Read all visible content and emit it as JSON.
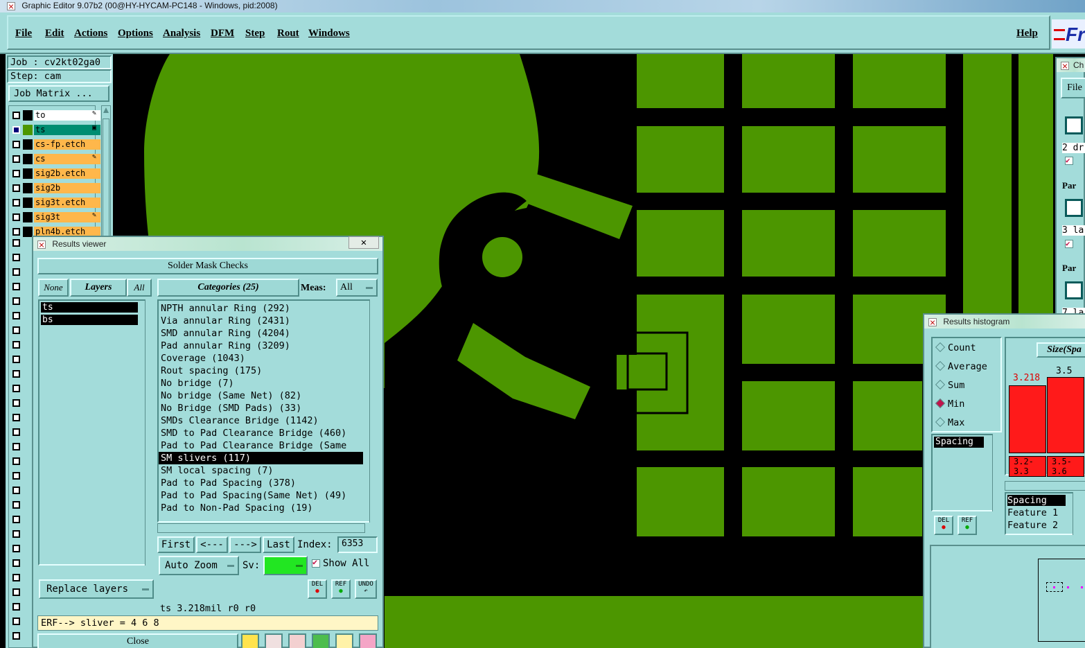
{
  "window_title": "Graphic Editor 9.07b2 (00@HY-HYCAM-PC148 - Windows, pid:2008)",
  "menu": [
    "File",
    "Edit",
    "Actions",
    "Options",
    "Analysis",
    "DFM",
    "Step",
    "Rout",
    "Windows"
  ],
  "help_label": "Help",
  "logo_text": "Fr",
  "job_label": "Job : cv2kt02ga0",
  "step_label": "Step: cam",
  "job_matrix_label": "Job Matrix ...",
  "layers": [
    {
      "name": "to",
      "color": "#ffffff",
      "flag": "✎"
    },
    {
      "name": "ts",
      "color": "#008d72",
      "flag": "▣"
    },
    {
      "name": "cs-fp.etch",
      "color": "#ffb74b",
      "flag": ""
    },
    {
      "name": "cs",
      "color": "#ffb74b",
      "flag": "✎"
    },
    {
      "name": "sig2b.etch",
      "color": "#ffb74b",
      "flag": ""
    },
    {
      "name": "sig2b",
      "color": "#ffb74b",
      "flag": ""
    },
    {
      "name": "sig3t.etch",
      "color": "#ffb74b",
      "flag": ""
    },
    {
      "name": "sig3t",
      "color": "#ffb74b",
      "flag": "✎"
    },
    {
      "name": "pln4b.etch",
      "color": "#ffb74b",
      "flag": ""
    }
  ],
  "results_viewer": {
    "title": "Results viewer",
    "header": "Solder Mask Checks",
    "none_label": "None",
    "layers_label": "Layers",
    "all_label": "All",
    "categories_label": "Categories (25)",
    "meas_label": "Meas:",
    "meas_value": "All",
    "layer_list": [
      "ts",
      "bs"
    ],
    "categories": [
      "NPTH annular Ring (292)",
      "Via annular Ring (2431)",
      "SMD annular Ring (4204)",
      "Pad annular Ring (3209)",
      "Coverage (1043)",
      "Rout spacing (175)",
      "No bridge (7)",
      "No bridge (Same Net) (82)",
      "No Bridge (SMD Pads) (33)",
      "SMDs Clearance Bridge (1142)",
      "SMD to Pad Clearance Bridge (460)",
      "Pad to Pad Clearance Bridge (Same",
      "SM slivers (117)",
      "SM local spacing (7)",
      "Pad to Pad Spacing (378)",
      "Pad to Pad Spacing(Same Net) (49)",
      "Pad to Non-Pad Spacing (19)"
    ],
    "selected_category": "SM slivers (117)",
    "first_label": "First",
    "prev_label": "<---",
    "next_label": "--->",
    "last_label": "Last",
    "index_label": "Index:",
    "index_value": "6353",
    "auto_zoom_label": "Auto Zoom",
    "sv_label": "Sv:",
    "show_all_label": "Show All",
    "replace_layers_label": "Replace layers",
    "del_label": "DEL",
    "ref_label": "REF",
    "undo_label": "UNDO",
    "status_line": "ts 3.218mil  r0  r0",
    "erf_line": "ERF--> sliver = 4 6 8",
    "close_label": "Close"
  },
  "histogram": {
    "title": "Results histogram",
    "options": [
      "Count",
      "Average",
      "Sum",
      "Min",
      "Max"
    ],
    "selected_option": "Min",
    "list_header": "Spacing",
    "size_label": "Size(Spa",
    "bar_values": [
      "3.218",
      "3.5"
    ],
    "bar_ranges": [
      "3.2-\n3.3",
      "3.5-\n3.6"
    ],
    "bottom_list": [
      "Spacing",
      "Feature 1",
      "Feature 2"
    ],
    "del_label": "DEL",
    "ref_label": "REF"
  },
  "right_panel": {
    "title": "Ch",
    "file_label": "File",
    "rows": [
      "2 dr",
      "Par",
      "3 la",
      "Par",
      "7 la"
    ]
  }
}
